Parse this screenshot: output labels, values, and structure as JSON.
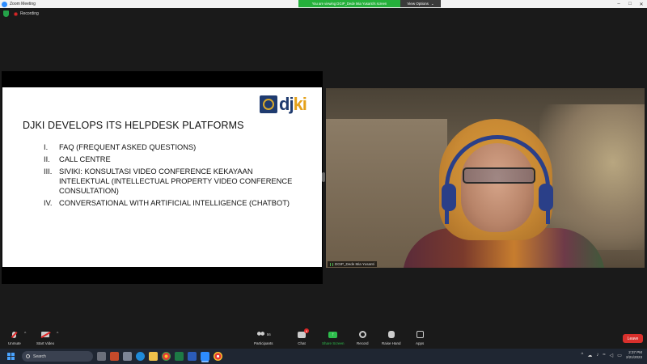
{
  "window": {
    "title": "Zoom Meeting",
    "controls": [
      "–",
      "□",
      "✕"
    ]
  },
  "viewing_banner": {
    "text": "You are viewing DGIP_Dede Mia Yusanti's screen",
    "view_options_label": "View Options",
    "view_options_caret": "⌄"
  },
  "recording": {
    "label": "Recording"
  },
  "slide": {
    "logo_text_primary": "dj",
    "logo_text_accent": "ki",
    "heading": "DJKI DEVELOPS ITS HELPDESK PLATFORMS",
    "items": [
      {
        "num": "I.",
        "text": "FAQ (FREQUENT ASKED QUESTIONS)"
      },
      {
        "num": "II.",
        "text": "CALL CENTRE"
      },
      {
        "num": "III.",
        "text": "SIVIKI: KONSULTASI VIDEO CONFERENCE KEKAYAAN INTELEKTUAL (INTELLECTUAL PROPERTY VIDEO CONFERENCE CONSULTATION)"
      },
      {
        "num": "IV.",
        "text": "CONVERSATIONAL WITH ARTIFICIAL INTELLIGENCE (CHATBOT)"
      }
    ]
  },
  "video": {
    "participant_name": "DGIP_Dede Mia Yusanti"
  },
  "toolbar": {
    "unmute_label": "Unmute",
    "start_video_label": "Start Video",
    "participants_label": "Participants",
    "participants_count": "56",
    "chat_label": "Chat",
    "chat_badge": "9",
    "share_screen_label": "Share Screen",
    "record_label": "Record",
    "raise_hand_label": "Raise Hand",
    "apps_label": "Apps",
    "leave_label": "Leave",
    "caret": "^"
  },
  "taskbar": {
    "search_placeholder": "Search",
    "time": "2:37 PM",
    "date": "2/21/2023",
    "tray_caret": "^",
    "tray_icons": [
      "cloud-icon",
      "mic-icon",
      "wifi-icon",
      "volume-icon",
      "battery-icon"
    ]
  },
  "colors": {
    "zoom_blue": "#2d8cff",
    "share_green": "#2dbd4c",
    "banner_green": "#25b03b",
    "leave_red": "#d9302c",
    "logo_navy": "#1f3b6f",
    "logo_gold": "#e4a11b"
  }
}
